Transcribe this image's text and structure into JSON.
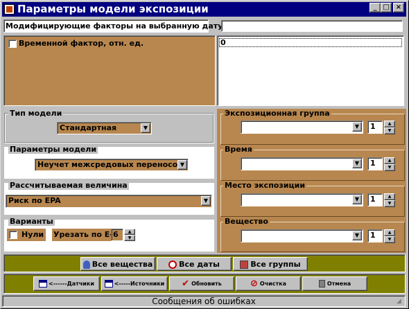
{
  "window": {
    "title": "Параметры модели экспозиции",
    "minimize": "_",
    "maximize": "□",
    "close": "×"
  },
  "modifiers": {
    "label": "Модифицирующие факторы на выбранную дату",
    "value": ""
  },
  "factor": {
    "checkbox_label": "Временной фактор, отн. ед.",
    "list_value": "0"
  },
  "model_type": {
    "legend": "Тип модели",
    "value": "Стандартная"
  },
  "model_params": {
    "legend": "Параметры модели",
    "value": "Неучет межсредовых переносов"
  },
  "calc_value": {
    "legend": "Рассчитываемая величина",
    "value": "Риск по EPA"
  },
  "variants": {
    "legend": "Варианты",
    "nulls_label": "Нули",
    "trim_label": "Урезать по Е-",
    "trim_value": "6"
  },
  "exposure_group": {
    "legend": "Экспозиционная группа",
    "value": "",
    "spin_value": "1"
  },
  "time": {
    "legend": "Время",
    "value": "",
    "spin_value": "1"
  },
  "exposure_place": {
    "legend": "Место экспозиции",
    "value": "",
    "spin_value": "1"
  },
  "substance": {
    "legend": "Вещество",
    "value": "",
    "spin_value": "1"
  },
  "select_buttons": {
    "all_substances": "Все вещества",
    "all_dates": "Все даты",
    "all_groups": "Все группы"
  },
  "action_buttons": {
    "sensors": "<------Датчики",
    "sources": "<-----Источники",
    "refresh": "Обновить",
    "clear": "Очистка",
    "cancel": "Отмена"
  },
  "status": {
    "text": "Сообщения об ошибках"
  },
  "colors": {
    "title_bar": "#000080",
    "brown_panel": "#b8874f",
    "olive_bar": "#808000"
  }
}
